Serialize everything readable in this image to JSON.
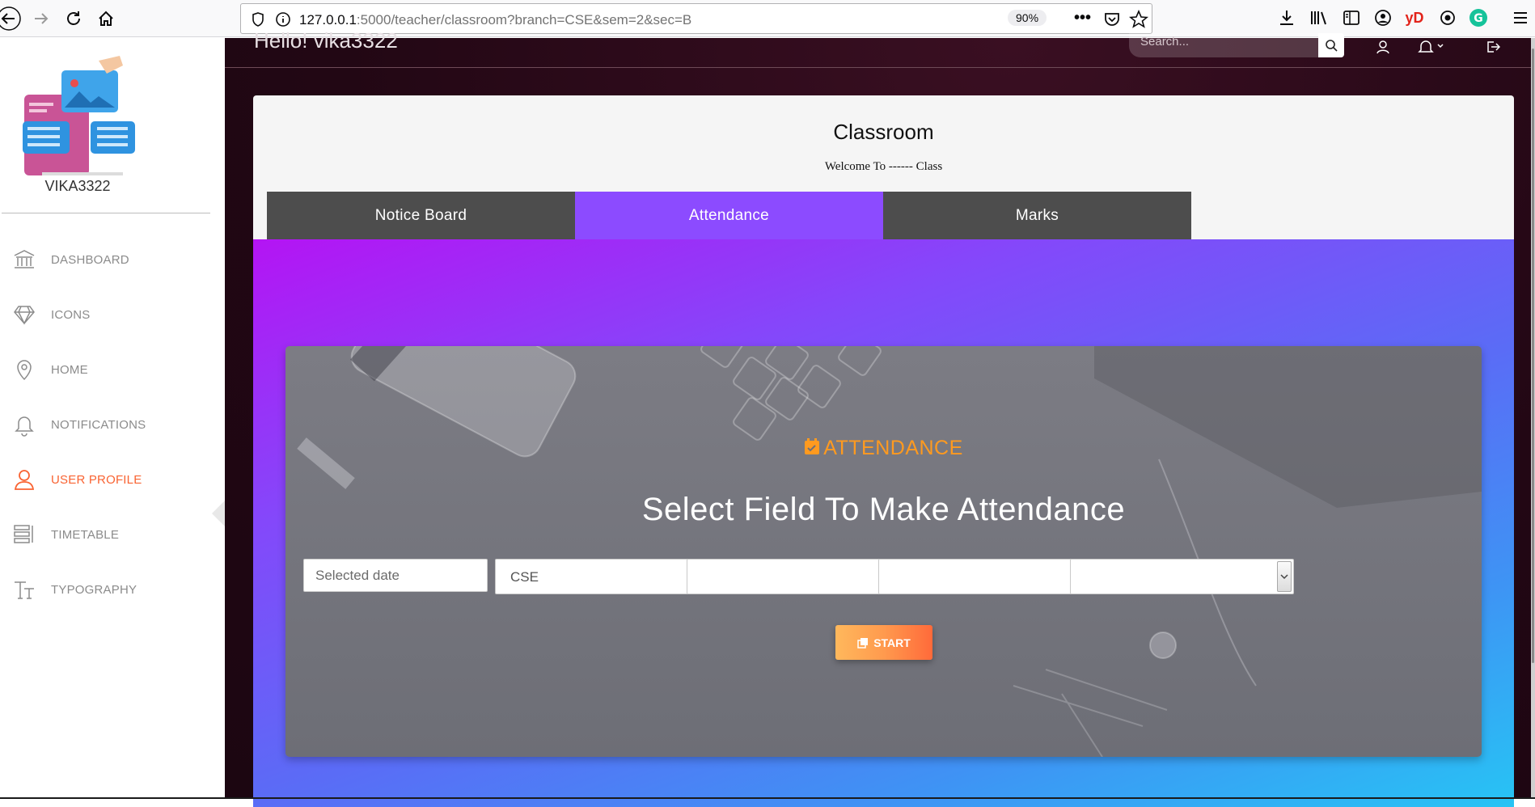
{
  "browser": {
    "url_host": "127.0.0.1",
    "url_rest": ":5000/teacher/classroom?branch=CSE&sem=2&sec=B",
    "zoom": "90%"
  },
  "sidebar": {
    "username": "VIKA3322",
    "items": [
      {
        "label": "DASHBOARD",
        "icon": "bank-icon",
        "active": false
      },
      {
        "label": "ICONS",
        "icon": "diamond-icon",
        "active": false
      },
      {
        "label": "HOME",
        "icon": "map-pin-icon",
        "active": false
      },
      {
        "label": "NOTIFICATIONS",
        "icon": "bell-icon",
        "active": false
      },
      {
        "label": "USER PROFILE",
        "icon": "user-icon",
        "active": true
      },
      {
        "label": "TIMETABLE",
        "icon": "list-icon",
        "active": false
      },
      {
        "label": "TYPOGRAPHY",
        "icon": "text-size-icon",
        "active": false
      }
    ]
  },
  "topbar": {
    "greeting": "Hello! vika3322",
    "search_placeholder": "Search..."
  },
  "classroom": {
    "title": "Classroom",
    "subtitle": "Welcome To ------ Class",
    "tabs": [
      {
        "label": "Notice Board",
        "active": false
      },
      {
        "label": "Attendance",
        "active": true
      },
      {
        "label": "Marks",
        "active": false
      }
    ]
  },
  "attendance": {
    "section_label": "ATTENDANCE",
    "heading": "Select Field To Make Attendance",
    "date_placeholder": "Selected date",
    "selects": [
      "CSE",
      "",
      "",
      ""
    ],
    "start_label": "START"
  },
  "colors": {
    "accent_orange": "#f96332",
    "tab_active": "#8c4bff",
    "tab_inactive": "#4d4d4d",
    "attendance_orange": "#ff9a1f"
  }
}
